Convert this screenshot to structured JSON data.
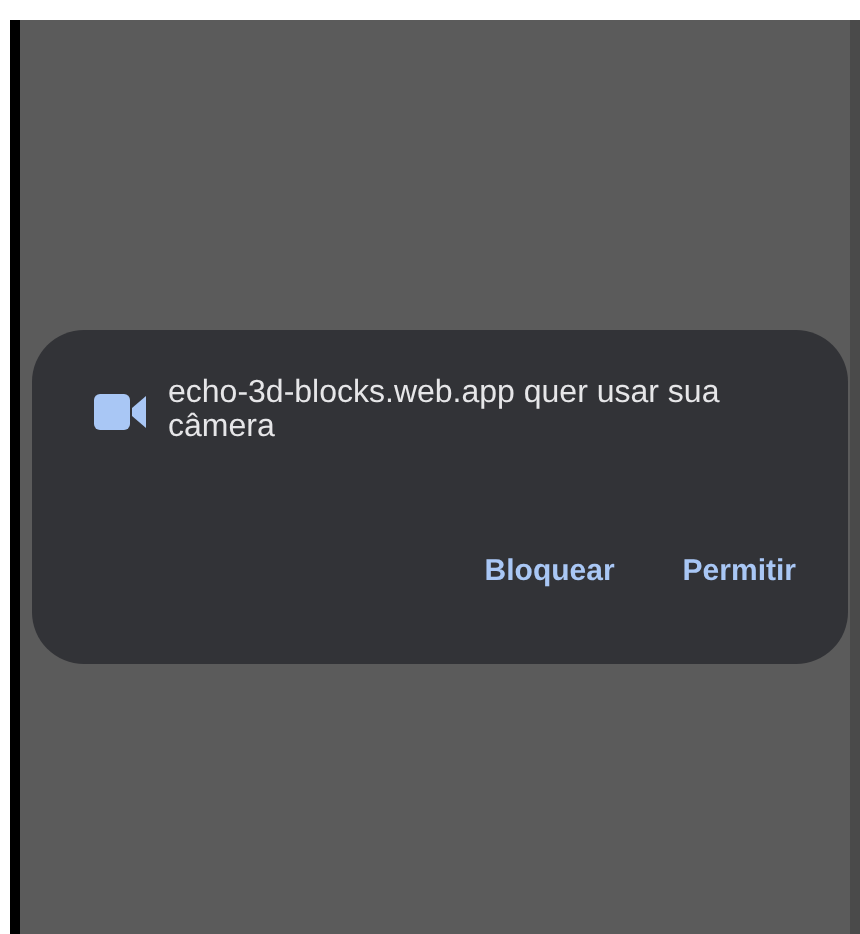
{
  "dialog": {
    "message": "echo-3d-blocks.web.app quer usar sua câmera",
    "buttons": [
      {
        "label": "Bloquear"
      },
      {
        "label": "Permitir"
      }
    ]
  }
}
